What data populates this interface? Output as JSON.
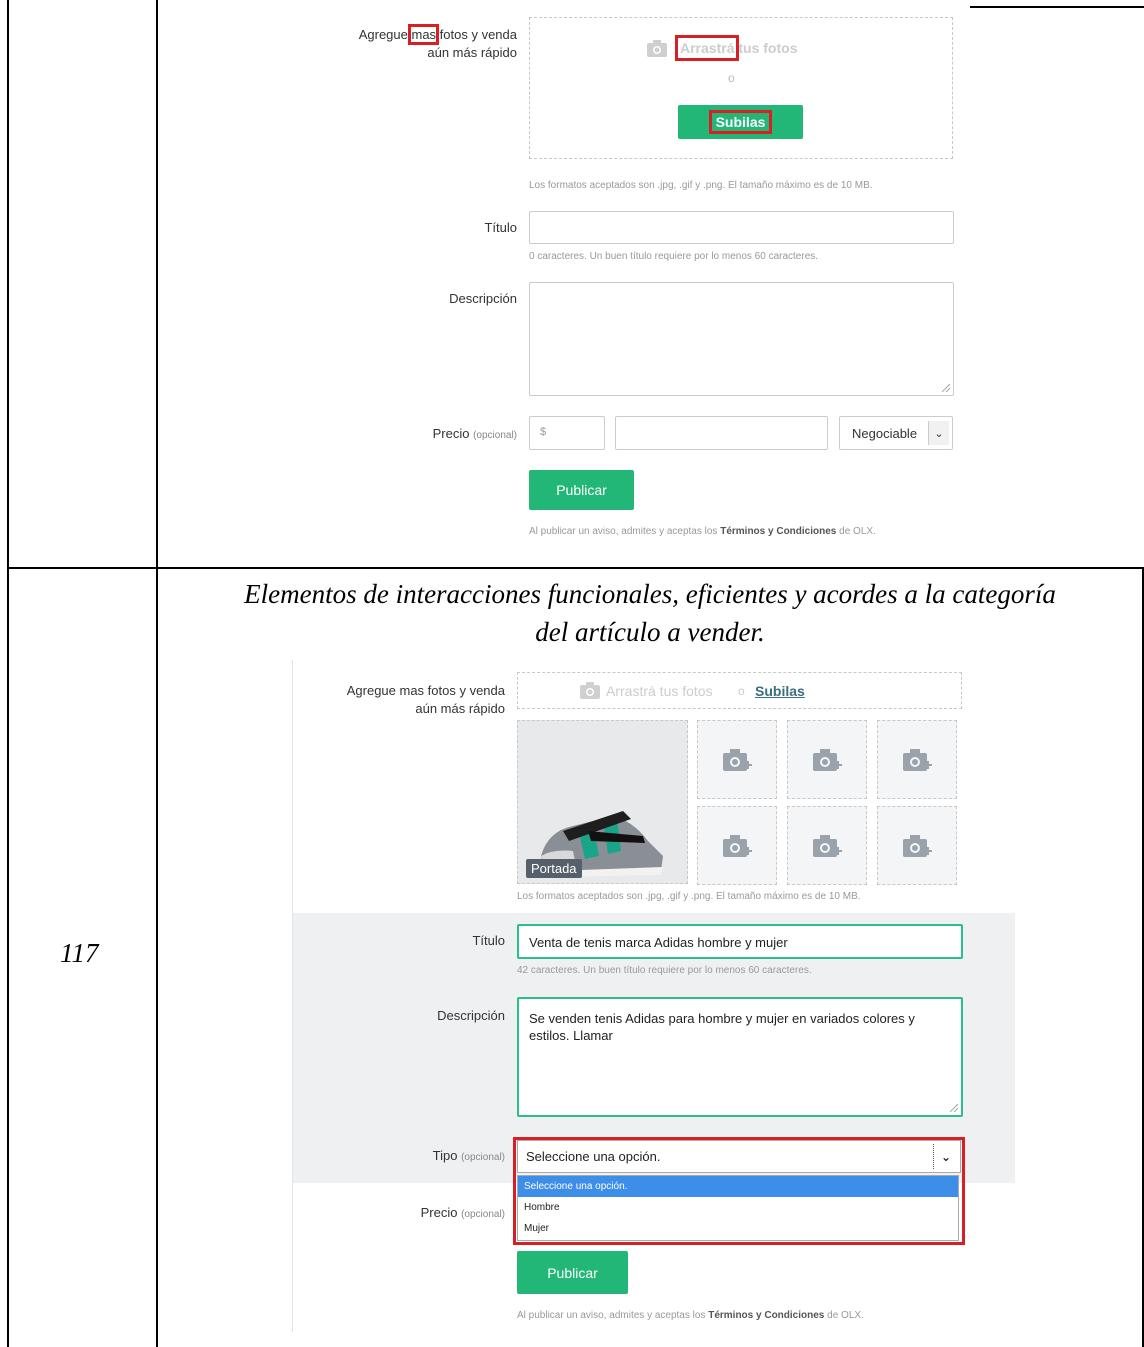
{
  "row_number": "117",
  "caption": {
    "line1": "Elementos de interacciones funcionales, eficientes y acordes a la categoría",
    "line2": "del artículo a vender."
  },
  "top_form": {
    "photos_label_line1": "Agregue mas fotos y venda",
    "photos_label_line2": "aún más rápido",
    "photos_label_prefix": "Agregue ",
    "photos_label_highlight": "mas",
    "photos_label_suffix": " fotos y venda",
    "drag_highlight": "Arrastrá",
    "drag_rest": " tus fotos",
    "or": "o",
    "upload_button": "Subilas",
    "formats_hint": "Los formatos aceptados son .jpg, .gif y .png. El tamaño máximo es de 10 MB.",
    "title_label": "Título",
    "title_hint": "0 caracteres. Un buen título requiere por lo menos 60 caracteres.",
    "description_label": "Descripción",
    "price_label": "Precio",
    "price_optional": "(opcional)",
    "currency_symbol": "$",
    "negotiable_value": "Negociable",
    "publish_button": "Publicar",
    "terms_prefix": "Al publicar un aviso, admites y aceptas los ",
    "terms_link": "Términos y Condiciones",
    "terms_suffix": " de OLX."
  },
  "bottom_form": {
    "photos_label_line1": "Agregue mas fotos y venda",
    "photos_label_line2": "aún más rápido",
    "drag_text": "Arrastrá tus fotos",
    "or": "o",
    "upload_link": "Subilas",
    "cover_badge": "Portada",
    "formats_hint": "Los formatos aceptados son .jpg, .gif y .png. El tamaño máximo es de 10 MB.",
    "title_label": "Título",
    "title_value": "Venta de tenis marca Adidas hombre y mujer",
    "title_hint": "42 caracteres. Un buen título requiere por lo menos 60 caracteres.",
    "description_label": "Descripción",
    "description_value": "Se venden tenis Adidas para hombre y mujer en variados colores y estilos. Llamar",
    "type_label": "Tipo",
    "type_optional": "(opcional)",
    "type_selected": "Seleccione una opción.",
    "type_options": [
      "Seleccione una opción.",
      "Hombre",
      "Mujer"
    ],
    "price_label": "Precio",
    "price_optional": "(opcional)",
    "publish_button": "Publicar",
    "terms_prefix": "Al publicar un aviso, admites y aceptas los ",
    "terms_link": "Términos y Condiciones",
    "terms_suffix": " de OLX."
  },
  "colors": {
    "green": "#23b777",
    "highlight_red": "#d81f26",
    "dropdown_blue": "#3d8ee8"
  }
}
